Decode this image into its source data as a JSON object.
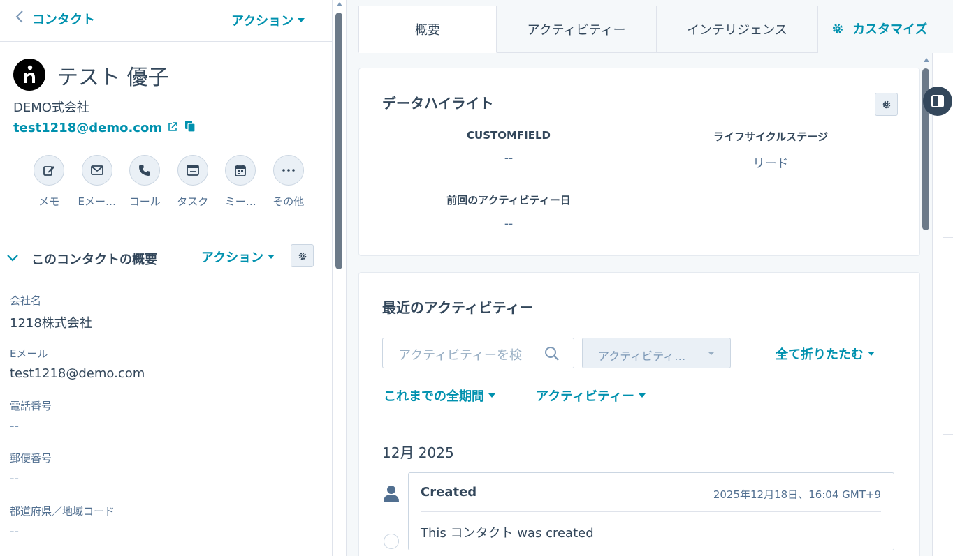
{
  "header": {
    "back_label": "コンタクト",
    "action_label": "アクション"
  },
  "profile": {
    "name": "テスト 優子",
    "company": "DEMO式会社",
    "email": "test1218@demo.com"
  },
  "quick_actions": [
    {
      "icon": "edit-icon",
      "label": "メモ"
    },
    {
      "icon": "envelope-icon",
      "label": "Eメー…"
    },
    {
      "icon": "phone-icon",
      "label": "コール"
    },
    {
      "icon": "task-icon",
      "label": "タスク"
    },
    {
      "icon": "calendar-icon",
      "label": "ミー…"
    },
    {
      "icon": "more-icon",
      "label": "その他"
    }
  ],
  "about": {
    "title": "このコンタクトの概要",
    "action_label": "アクション",
    "fields": [
      {
        "label": "会社名",
        "value": "1218株式会社"
      },
      {
        "label": "Eメール",
        "value": "test1218@demo.com"
      },
      {
        "label": "電話番号",
        "value": "--"
      },
      {
        "label": "郵便番号",
        "value": "--"
      },
      {
        "label": "都道府県／地域コード",
        "value": "--"
      }
    ]
  },
  "tabs": [
    {
      "label": "概要",
      "active": true
    },
    {
      "label": "アクティビティー",
      "active": false
    },
    {
      "label": "インテリジェンス",
      "active": false
    }
  ],
  "customize_label": "カスタマイズ",
  "highlights": {
    "title": "データハイライト",
    "props": [
      {
        "label": "CUSTOMFIELD",
        "value": "--"
      },
      {
        "label": "ライフサイクルステージ",
        "value": "リード"
      },
      {
        "label": "前回のアクティビティー日",
        "value": "--"
      }
    ]
  },
  "recent": {
    "title": "最近のアクティビティー",
    "search_placeholder": "アクティビティーを検",
    "filter_value": "アクティビティ…",
    "collapse_label": "全て折りたたむ",
    "period_label": "これまでの全期間",
    "type_label": "アクティビティー",
    "month": "12月 2025",
    "entry": {
      "title": "Created",
      "date": "2025年12月18日、16:04 GMT+9",
      "body": "This コンタクト was created"
    }
  },
  "colors": {
    "accent": "#0091ae",
    "text": "#33475b",
    "muted": "#516f90",
    "bg": "#f5f8fa"
  }
}
